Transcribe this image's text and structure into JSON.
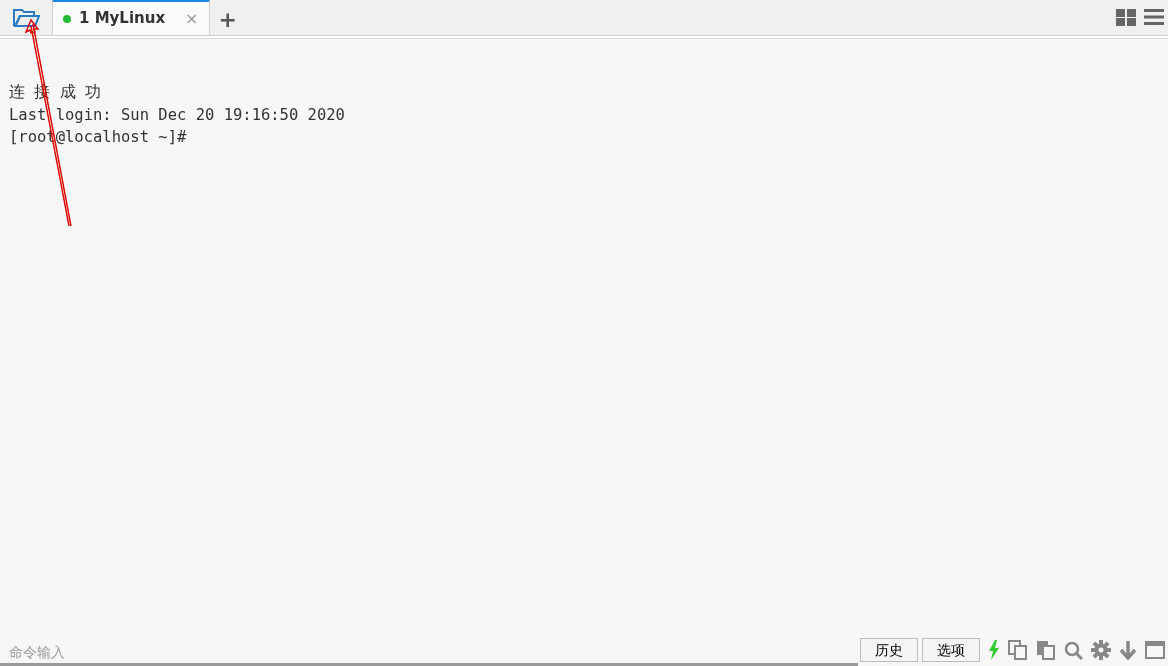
{
  "tabs": [
    {
      "number": "1",
      "label": "MyLinux",
      "selected": true,
      "connected": true,
      "close": "×"
    }
  ],
  "new_tab": "+",
  "terminal": {
    "lines": [
      "连 接 成 功",
      "Last login: Sun Dec 20 19:16:50 2020",
      "[root@localhost ~]#"
    ]
  },
  "command_input": {
    "placeholder": "命令输入"
  },
  "buttons": [
    "历史",
    "选项"
  ],
  "annotation": {
    "kind": "arrow"
  }
}
